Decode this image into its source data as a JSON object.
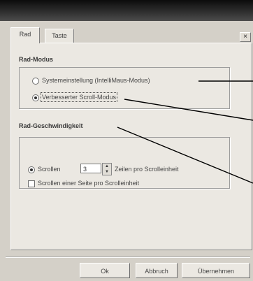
{
  "window": {
    "close_glyph": "×"
  },
  "tabs": [
    {
      "label": "Rad",
      "active": true
    },
    {
      "label": "Taste",
      "active": false
    }
  ],
  "rad_modus": {
    "heading": "Rad-Modus",
    "options": [
      {
        "label": "Systemeinstellung (IntelliMaus-Modus)",
        "selected": false
      },
      {
        "label": "Verbesserter Scroll-Modus",
        "selected": true
      }
    ]
  },
  "rad_geschwindigkeit": {
    "heading": "Rad-Geschwindigkeit",
    "scroll_lines": {
      "label": "Scrollen",
      "value": "3",
      "suffix": "Zeilen pro Scrolleinheit",
      "selected": true
    },
    "scroll_page": {
      "label": "Scrollen einer Seite pro Scrolleinheit",
      "checked": false
    }
  },
  "buttons": {
    "ok": "Ok",
    "cancel": "Abbruch",
    "apply": "Übernehmen"
  },
  "colors": {
    "callout_line": "#000000",
    "dialog_bg": "#d4d0c8",
    "title_bar": "#1a1a1a"
  }
}
